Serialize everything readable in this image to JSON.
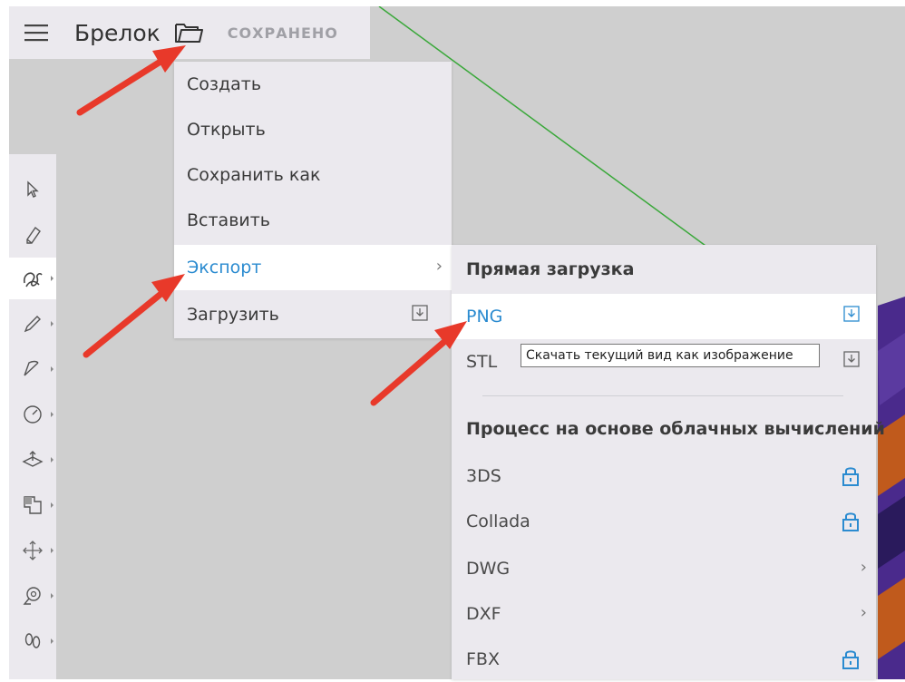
{
  "header": {
    "title": "Брелок",
    "saved_status": "СОХРАНЕНО",
    "menu_icon": "hamburger-icon",
    "folder_icon": "folder-icon"
  },
  "toolbar": {
    "tools": [
      "select-arrow-icon",
      "eraser-icon",
      "freehand-icon",
      "pencil-icon",
      "arc-icon",
      "circle-icon",
      "push-pull-icon",
      "offset-icon",
      "move-icon",
      "tape-measure-icon",
      "footsteps-icon"
    ]
  },
  "file_menu": {
    "items": [
      {
        "label": "Создать"
      },
      {
        "label": "Открыть"
      },
      {
        "label": "Сохранить как"
      },
      {
        "label": "Вставить"
      },
      {
        "label": "Экспорт",
        "has_submenu": true
      },
      {
        "label": "Загрузить",
        "icon": "download-icon"
      }
    ]
  },
  "export_submenu": {
    "direct_header": "Прямая загрузка",
    "direct_items": [
      {
        "label": "PNG",
        "icon": "download-icon"
      },
      {
        "label": "STL",
        "icon": "download-icon"
      }
    ],
    "cloud_header": "Процесс на основе облачных вычислений",
    "cloud_items": [
      {
        "label": "3DS",
        "icon": "lock-icon"
      },
      {
        "label": "Collada",
        "icon": "lock-icon"
      },
      {
        "label": "DWG",
        "icon": "chevron-right-icon"
      },
      {
        "label": "DXF",
        "icon": "chevron-right-icon"
      },
      {
        "label": "FBX",
        "icon": "lock-icon"
      }
    ]
  },
  "tooltip": {
    "text": "Скачать текущий вид как изображение"
  },
  "colors": {
    "accent": "#2b8bd0",
    "annotation_arrow": "#e8392a",
    "axis_line": "#3aa83a",
    "model_purple": "#4a2a8c",
    "model_orange": "#c05a1c"
  }
}
